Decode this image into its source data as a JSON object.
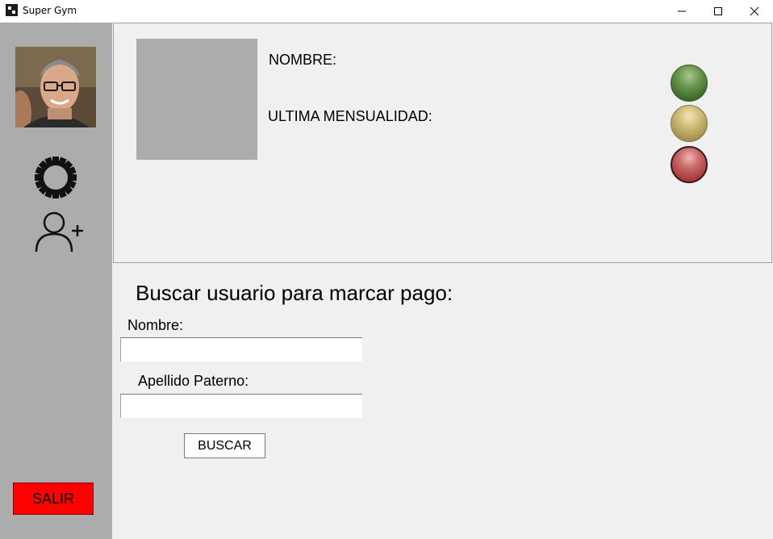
{
  "window": {
    "title": "Super Gym"
  },
  "sidebar": {
    "icons": [
      "avatar-photo",
      "gear-icon",
      "add-user-icon"
    ],
    "exit_label": "SALIR"
  },
  "info_panel": {
    "name_label": "NOMBRE:",
    "last_payment_label": "ULTIMA MENSUALIDAD:",
    "status_lights": [
      "green",
      "yellow",
      "red"
    ]
  },
  "search": {
    "title": "Buscar usuario para marcar pago:",
    "first_name_label": "Nombre:",
    "first_name_value": "",
    "last_name_label": "Apellido Paterno:",
    "last_name_value": "",
    "button_label": "BUSCAR"
  },
  "colors": {
    "sidebar_bg": "#acacac",
    "exit_button": "#ff0000",
    "light_green": "#4f7a36",
    "light_yellow": "#bca765",
    "light_red": "#b34848"
  }
}
